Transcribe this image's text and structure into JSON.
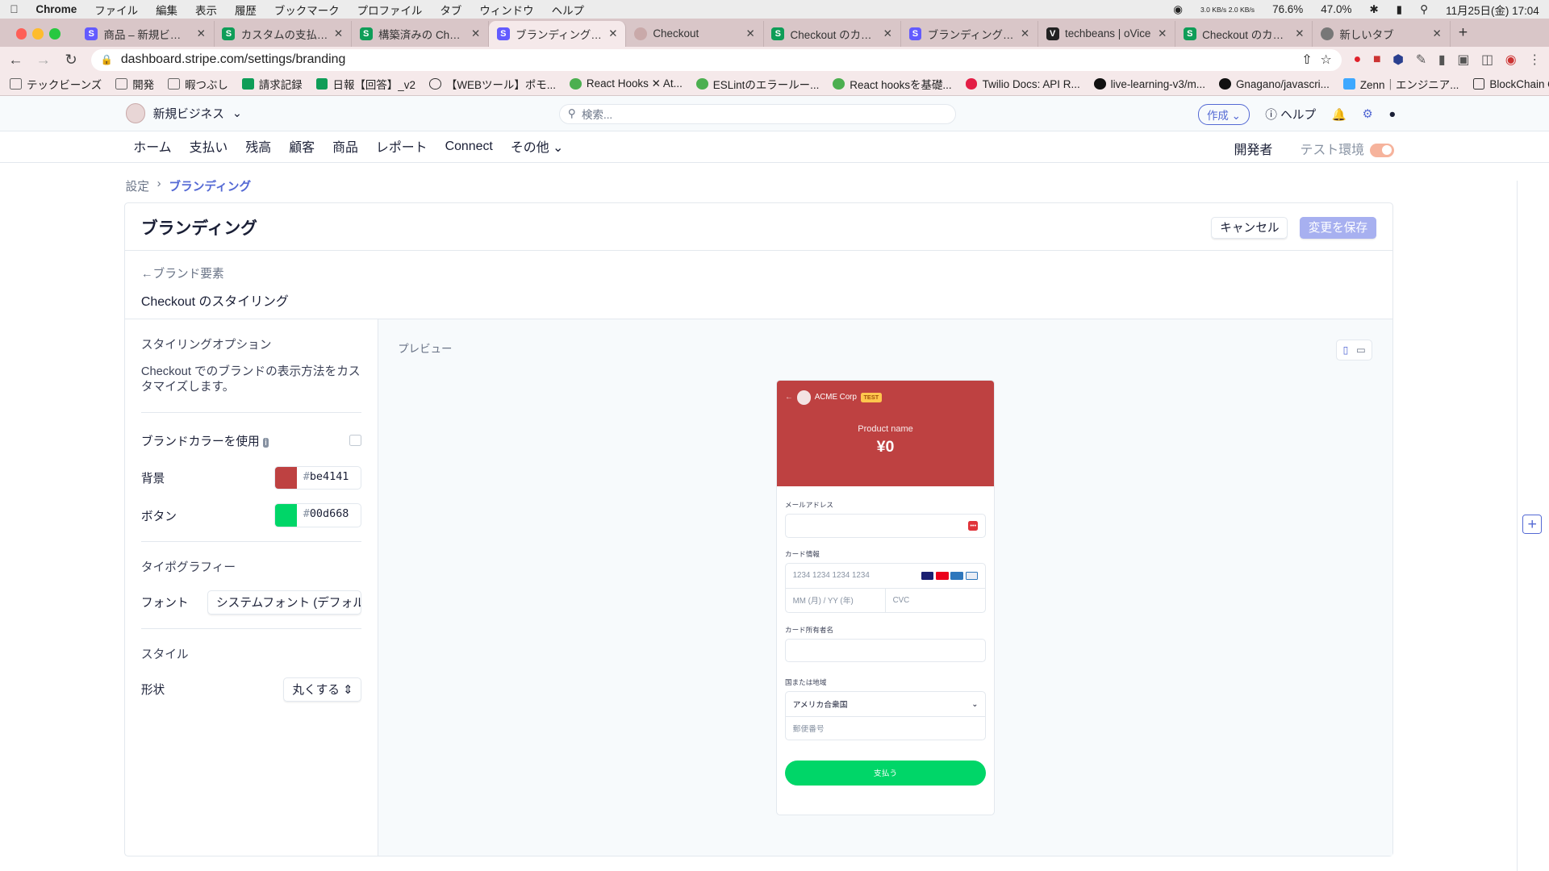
{
  "macos": {
    "app": "Chrome",
    "menus": [
      "ファイル",
      "編集",
      "表示",
      "履歴",
      "ブックマーク",
      "プロファイル",
      "タブ",
      "ウィンドウ",
      "ヘルプ"
    ],
    "status": [
      "3.0 KB/s 2.0 KB/s",
      "76.6%",
      "47.0%"
    ],
    "clock": "11月25日(金)  17:04"
  },
  "tabs": [
    {
      "title": "商品 – 新規ビジネス",
      "icon": "stripe-s",
      "color": "#635bff"
    },
    {
      "title": "カスタムの支払いフロー",
      "icon": "sheets-s",
      "color": "#0f9d58"
    },
    {
      "title": "構築済みの Checkout",
      "icon": "sheets-s",
      "color": "#0f9d58"
    },
    {
      "title": "ブランディング – 新規",
      "icon": "stripe-s",
      "color": "#635bff"
    },
    {
      "title": "Checkout",
      "icon": "avatar",
      "color": "#c9a9a9"
    },
    {
      "title": "Checkout のカスタム",
      "icon": "sheets-s",
      "color": "#0f9d58"
    },
    {
      "title": "ブランディング – 新規",
      "icon": "stripe-s",
      "color": "#635bff"
    },
    {
      "title": "techbeans | oVice",
      "icon": "ovice-v",
      "color": "#222222"
    },
    {
      "title": "Checkout のカスタム",
      "icon": "sheets-s",
      "color": "#0f9d58"
    },
    {
      "title": "新しいタブ",
      "icon": "chrome",
      "color": "#777777"
    }
  ],
  "url": "dashboard.stripe.com/settings/branding",
  "bookmarks": [
    "テックビーンズ",
    "開発",
    "暇つぶし",
    "請求記録",
    "日報【回答】_v2",
    "【WEBツール】ポモ...",
    "React Hooks ✕ At...",
    "ESLintのエラールー...",
    "React hooksを基礎...",
    "Twilio Docs: API R...",
    "live-learning-v3/m...",
    "Gnagano/javascri...",
    "Zenn｜エンジニア...",
    "BlockChain Online..."
  ],
  "stripe": {
    "account": "新規ビジネス",
    "search_placeholder": "検索...",
    "create": "作成",
    "help": "ヘルプ",
    "nav": [
      "ホーム",
      "支払い",
      "残高",
      "顧客",
      "商品",
      "レポート",
      "Connect",
      "その他"
    ],
    "developer": "開発者",
    "test_env": "テスト環境"
  },
  "breadcrumb": {
    "parent": "設定",
    "current": "ブランディング"
  },
  "page": {
    "title": "ブランディング",
    "cancel": "キャンセル",
    "save": "変更を保存",
    "back": "ブランド要素",
    "subtitle": "Checkout のスタイリング"
  },
  "options": {
    "heading": "スタイリングオプション",
    "desc": "Checkout でのブランドの表示方法をカスタマイズします。",
    "use_brand_color": "ブランドカラーを使用",
    "bg_label": "背景",
    "bg_color": "#be4141",
    "bg_hex": "be4141",
    "btn_label": "ボタン",
    "btn_color": "#00d668",
    "btn_hex": "00d668",
    "typography": "タイポグラフィー",
    "font_label": "フォント",
    "font_value": "システムフォント (デフォルト)",
    "style": "スタイル",
    "shape_label": "形状",
    "shape_value": "丸くする"
  },
  "preview": {
    "label": "プレビュー",
    "company": "ACME Corp",
    "test_badge": "TEST",
    "product": "Product name",
    "price": "¥0",
    "email": "メールアドレス",
    "card_info": "カード情報",
    "card_ph": "1234 1234 1234 1234",
    "exp_ph": "MM (月) / YY (年)",
    "cvc_ph": "CVC",
    "holder": "カード所有者名",
    "country_label": "国または地域",
    "country": "アメリカ合衆国",
    "zip_ph": "郵便番号",
    "pay": "支払う"
  }
}
